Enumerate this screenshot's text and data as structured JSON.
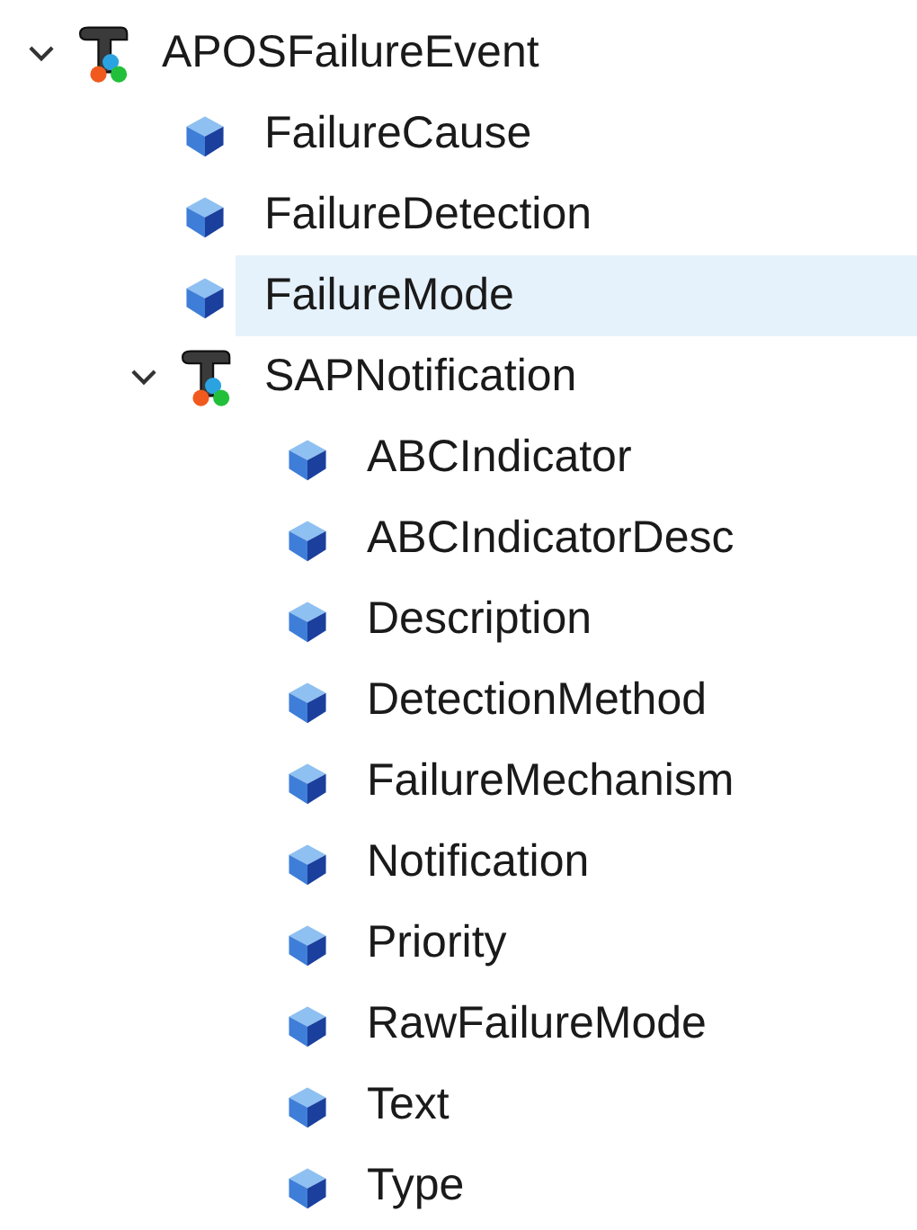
{
  "tree": [
    {
      "kind": "class",
      "label": "APOSFailureEvent",
      "expanded": true,
      "selected": false,
      "children": [
        {
          "kind": "property",
          "label": "FailureCause",
          "selected": false
        },
        {
          "kind": "property",
          "label": "FailureDetection",
          "selected": false
        },
        {
          "kind": "property",
          "label": "FailureMode",
          "selected": true
        },
        {
          "kind": "class",
          "label": "SAPNotification",
          "expanded": true,
          "selected": false,
          "children": [
            {
              "kind": "property",
              "label": "ABCIndicator",
              "selected": false
            },
            {
              "kind": "property",
              "label": "ABCIndicatorDesc",
              "selected": false
            },
            {
              "kind": "property",
              "label": "Description",
              "selected": false
            },
            {
              "kind": "property",
              "label": "DetectionMethod",
              "selected": false
            },
            {
              "kind": "property",
              "label": "FailureMechanism",
              "selected": false
            },
            {
              "kind": "property",
              "label": "Notification",
              "selected": false
            },
            {
              "kind": "property",
              "label": "Priority",
              "selected": false
            },
            {
              "kind": "property",
              "label": "RawFailureMode",
              "selected": false
            },
            {
              "kind": "property",
              "label": "Text",
              "selected": false
            },
            {
              "kind": "property",
              "label": "Type",
              "selected": false
            }
          ]
        }
      ]
    }
  ]
}
